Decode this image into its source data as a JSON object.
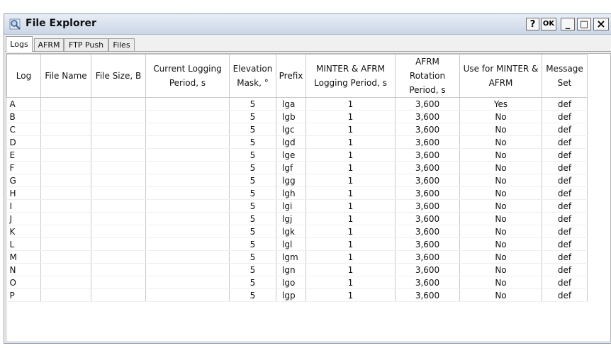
{
  "window": {
    "title": "File Explorer",
    "buttons": {
      "help": "?",
      "ok": "OK",
      "minimize": "_",
      "maximize": "□",
      "close": "×"
    }
  },
  "tabs": [
    {
      "label": "Logs",
      "active": true
    },
    {
      "label": "AFRM",
      "active": false
    },
    {
      "label": "FTP Push",
      "active": false
    },
    {
      "label": "Files",
      "active": false
    }
  ],
  "table": {
    "headers": [
      "Log",
      "File Name",
      "File Size, B",
      "Current Logging Period, s",
      "Elevation Mask, °",
      "Prefix",
      "MINTER & AFRM Logging Period, s",
      "AFRM Rotation Period, s",
      "Use for MINTER & AFRM",
      "Message Set"
    ],
    "rows": [
      [
        "A",
        "",
        "",
        "",
        "5",
        "lga",
        "1",
        "3,600",
        "Yes",
        "def"
      ],
      [
        "B",
        "",
        "",
        "",
        "5",
        "lgb",
        "1",
        "3,600",
        "No",
        "def"
      ],
      [
        "C",
        "",
        "",
        "",
        "5",
        "lgc",
        "1",
        "3,600",
        "No",
        "def"
      ],
      [
        "D",
        "",
        "",
        "",
        "5",
        "lgd",
        "1",
        "3,600",
        "No",
        "def"
      ],
      [
        "E",
        "",
        "",
        "",
        "5",
        "lge",
        "1",
        "3,600",
        "No",
        "def"
      ],
      [
        "F",
        "",
        "",
        "",
        "5",
        "lgf",
        "1",
        "3,600",
        "No",
        "def"
      ],
      [
        "G",
        "",
        "",
        "",
        "5",
        "lgg",
        "1",
        "3,600",
        "No",
        "def"
      ],
      [
        "H",
        "",
        "",
        "",
        "5",
        "lgh",
        "1",
        "3,600",
        "No",
        "def"
      ],
      [
        "I",
        "",
        "",
        "",
        "5",
        "lgi",
        "1",
        "3,600",
        "No",
        "def"
      ],
      [
        "J",
        "",
        "",
        "",
        "5",
        "lgj",
        "1",
        "3,600",
        "No",
        "def"
      ],
      [
        "K",
        "",
        "",
        "",
        "5",
        "lgk",
        "1",
        "3,600",
        "No",
        "def"
      ],
      [
        "L",
        "",
        "",
        "",
        "5",
        "lgl",
        "1",
        "3,600",
        "No",
        "def"
      ],
      [
        "M",
        "",
        "",
        "",
        "5",
        "lgm",
        "1",
        "3,600",
        "No",
        "def"
      ],
      [
        "N",
        "",
        "",
        "",
        "5",
        "lgn",
        "1",
        "3,600",
        "No",
        "def"
      ],
      [
        "O",
        "",
        "",
        "",
        "5",
        "lgo",
        "1",
        "3,600",
        "No",
        "def"
      ],
      [
        "P",
        "",
        "",
        "",
        "5",
        "lgp",
        "1",
        "3,600",
        "No",
        "def"
      ]
    ]
  }
}
